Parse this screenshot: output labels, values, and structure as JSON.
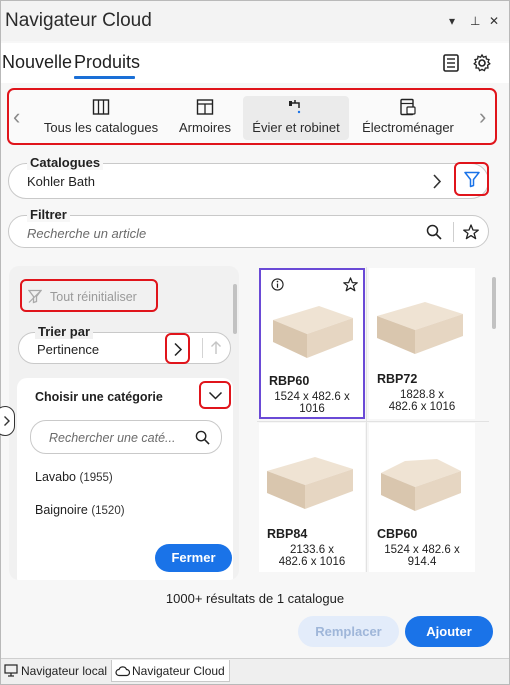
{
  "window": {
    "title": "Navigateur Cloud",
    "controls": {
      "menu": "▾",
      "pin": "⊥",
      "close": "✕"
    }
  },
  "header": {
    "tab_new": "Nouvelle",
    "tab_products": "Produits"
  },
  "categories_bar": {
    "items": [
      {
        "label": "Tous les catalogues",
        "icon": "catalog-icon"
      },
      {
        "label": "Armoires",
        "icon": "cabinet-icon"
      },
      {
        "label": "Évier et robinet",
        "icon": "faucet-icon",
        "active": true
      },
      {
        "label": "Électroménager",
        "icon": "appliance-icon"
      }
    ]
  },
  "catalogues": {
    "label": "Catalogues",
    "value": "Kohler Bath"
  },
  "filter": {
    "label": "Filtrer",
    "placeholder": "Recherche un article"
  },
  "sidebar": {
    "reset_label": "Tout réinitialiser",
    "sort_label": "Trier par",
    "sort_value": "Pertinence",
    "category_title": "Choisir une catégorie",
    "category_search_placeholder": "Rechercher une caté...",
    "categories": [
      {
        "name": "Lavabo",
        "count": "(1955)"
      },
      {
        "name": "Baignoire",
        "count": "(1520)"
      }
    ],
    "close_button": "Fermer"
  },
  "products": [
    {
      "name": "RBP60",
      "dims": [
        "1524 x  482.6 x",
        "1016"
      ],
      "selected": true
    },
    {
      "name": "RBP72",
      "dims": [
        "1828.8 x",
        "482.6 x  1016"
      ]
    },
    {
      "name": "RBP84",
      "dims": [
        "2133.6 x",
        "482.6 x  1016"
      ]
    },
    {
      "name": "CBP60",
      "dims": [
        "1524 x  482.6 x",
        "914.4"
      ]
    }
  ],
  "results_text": "1000+ résultats de 1 catalogue",
  "actions": {
    "replace": "Remplacer",
    "add": "Ajouter"
  },
  "bottom_tabs": {
    "local": "Navigateur local",
    "cloud": "Navigateur Cloud"
  },
  "colors": {
    "accent": "#1a73e8",
    "highlight_red": "#e0141b",
    "selected_border": "#6a4ad6"
  }
}
